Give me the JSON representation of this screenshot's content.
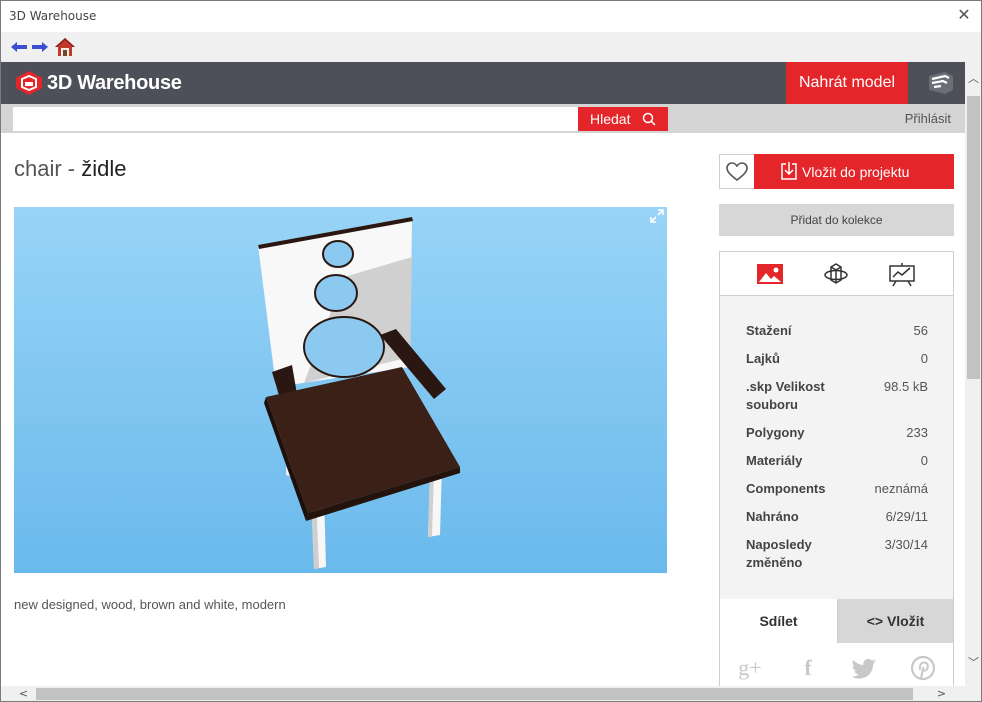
{
  "window": {
    "title": "3D Warehouse",
    "close_glyph": "✕"
  },
  "nav": {
    "back_icon": "back-arrow-icon",
    "forward_icon": "forward-arrow-icon",
    "home_icon": "home-icon"
  },
  "header": {
    "logo_text": "3D Warehouse",
    "upload_label": "Nahrát model",
    "brand_color": "#e4252a",
    "header_bg": "#4d5058"
  },
  "search": {
    "value": "",
    "placeholder": "",
    "button_label": "Hledat",
    "login_label": "Přihlásit"
  },
  "model": {
    "title_prefix": "chair - ",
    "title_main": "židle",
    "tags": "new designed, wood, brown and white, modern"
  },
  "actions": {
    "insert_label": "Vložit do projektu",
    "collection_label": "Přidat do kolekce"
  },
  "stats": [
    {
      "label": "Stažení",
      "value": "56"
    },
    {
      "label": "Lajků",
      "value": "0"
    },
    {
      "label": ".skp Velikost souboru",
      "value": "98.5 kB"
    },
    {
      "label": "Polygony",
      "value": "233"
    },
    {
      "label": "Materiály",
      "value": "0"
    },
    {
      "label": "Components",
      "value": "neznámá"
    },
    {
      "label": "Nahráno",
      "value": "6/29/11"
    },
    {
      "label": "Naposledy změněno",
      "value": "3/30/14"
    }
  ],
  "share": {
    "share_label": "Sdílet",
    "embed_label": "<> Vložit"
  },
  "social": {
    "gplus": "g+",
    "facebook": "f",
    "twitter": "twitter-icon",
    "pinterest": "pinterest-icon"
  }
}
